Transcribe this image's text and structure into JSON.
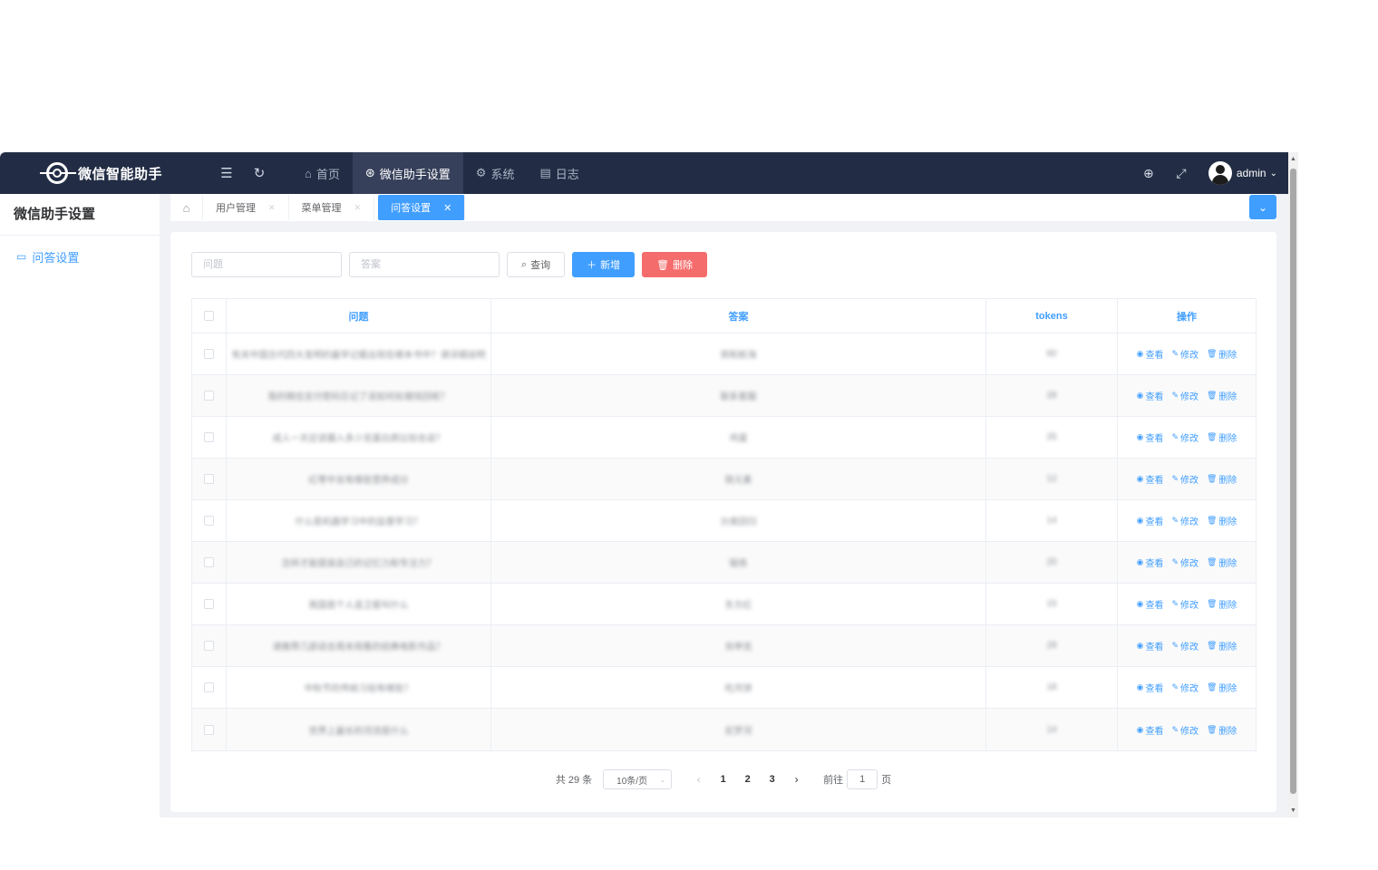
{
  "header": {
    "app_title": "微信智能助手",
    "nav": [
      {
        "label": "首页",
        "icon": "⌂"
      },
      {
        "label": "微信助手设置",
        "icon": "⊛"
      },
      {
        "label": "系统",
        "icon": "⚙"
      },
      {
        "label": "日志",
        "icon": "▤"
      }
    ],
    "user": "admin"
  },
  "sidebar": {
    "title": "微信助手设置",
    "items": [
      {
        "label": "问答设置",
        "icon": "▭"
      }
    ]
  },
  "tags": [
    {
      "label": "用户管理"
    },
    {
      "label": "菜单管理"
    },
    {
      "label": "问答设置"
    }
  ],
  "filters": {
    "question_placeholder": "问题",
    "answer_placeholder": "答案",
    "search_label": "查询",
    "add_label": "新增",
    "delete_label": "删除"
  },
  "table": {
    "headers": [
      "问题",
      "答案",
      "tokens",
      "操作"
    ],
    "actions": {
      "view": "查看",
      "edit": "修改",
      "delete": "删除"
    },
    "rows": [
      {
        "q": "有关中国古代四大发明的最早记载出现在哪本书中？请详细说明",
        "a": "郑和航海",
        "t": "60"
      },
      {
        "q": "我的微信支付密码忘记了该如何处理找回呢？",
        "a": "联系客服",
        "t": "28"
      },
      {
        "q": "成人一天应该摄入多少克蛋白质比较合适？",
        "a": "鸡蛋",
        "t": "25"
      },
      {
        "q": "红枣中含有哪些营养成分",
        "a": "铁元素",
        "t": "12"
      },
      {
        "q": "什么是机器学习中的监督学习？",
        "a": "分类回归",
        "t": "14"
      },
      {
        "q": "怎样才能提高自己的记忆力和专注力？",
        "a": "锻炼",
        "t": "20"
      },
      {
        "q": "我国首个人造卫星叫什么",
        "a": "东方红",
        "t": "15"
      },
      {
        "q": "请推荐几部适合周末观看的经典电影作品？",
        "a": "肖申克",
        "t": "29"
      },
      {
        "q": "中秋节的传统习俗有哪些？",
        "a": "吃月饼",
        "t": "18"
      },
      {
        "q": "世界上最长的河流是什么",
        "a": "尼罗河",
        "t": "14"
      }
    ]
  },
  "pagination": {
    "total": "共 29 条",
    "page_size": "10条/页",
    "pages": [
      "1",
      "2",
      "3"
    ],
    "goto_label": "前往",
    "goto_value": "1",
    "goto_suffix": "页"
  }
}
